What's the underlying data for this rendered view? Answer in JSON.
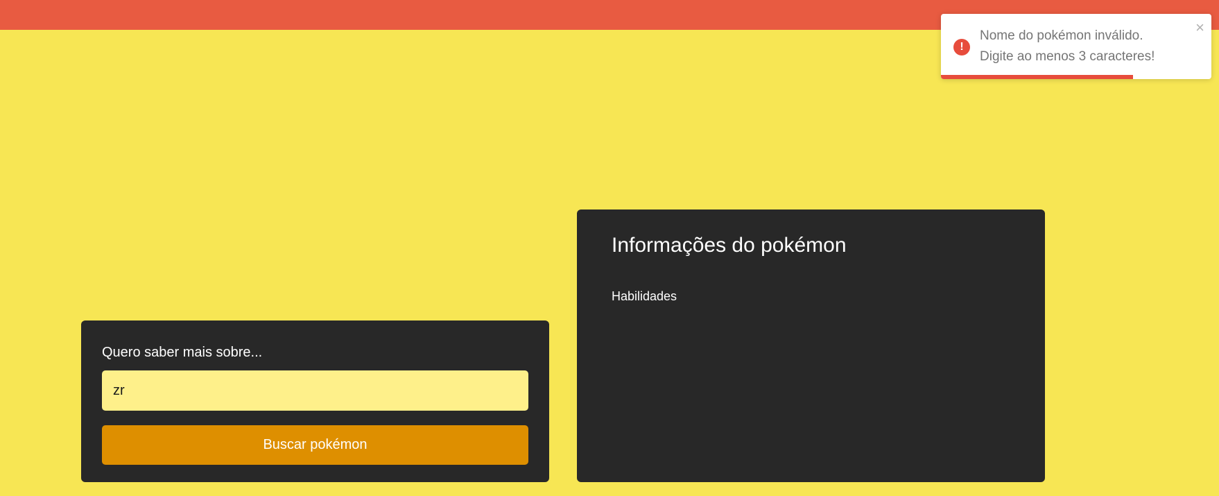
{
  "colors": {
    "background": "#f7e654",
    "top_bar": "#e85b41",
    "panel": "#282828",
    "input_bg": "#fef08a",
    "button_bg": "#de8f00",
    "toast_accent": "#e74c3c"
  },
  "search": {
    "label": "Quero saber mais sobre...",
    "value": "zr",
    "placeholder": "",
    "button_label": "Buscar pokémon"
  },
  "info": {
    "title": "Informações do pokémon",
    "abilities_label": "Habilidades"
  },
  "toast": {
    "type": "error",
    "icon": "exclamation-circle-icon",
    "icon_glyph": "!",
    "message_line1": "Nome do pokémon inválido.",
    "message_line2": "Digite ao menos 3 caracteres!",
    "close_glyph": "×",
    "progress_fraction": 0.71
  }
}
